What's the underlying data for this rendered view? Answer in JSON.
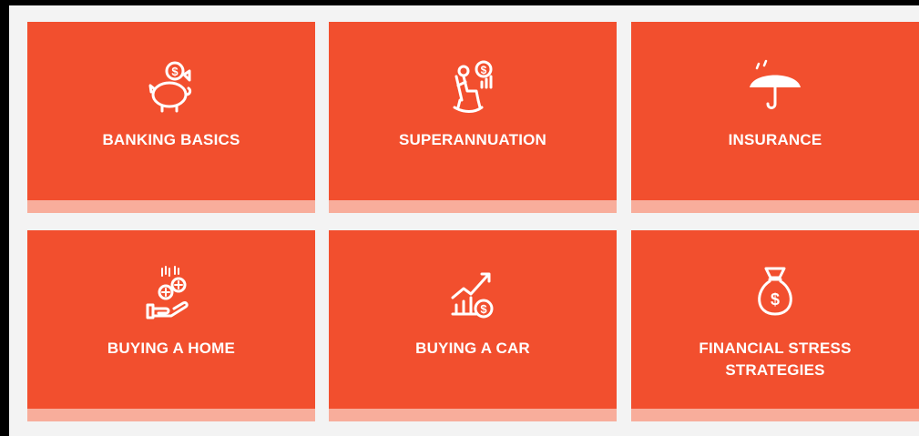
{
  "tiles": [
    {
      "label": "BANKING BASICS",
      "icon": "piggy-bank-icon"
    },
    {
      "label": "SUPERANNUATION",
      "icon": "retiree-rocking-chair-icon"
    },
    {
      "label": "INSURANCE",
      "icon": "umbrella-icon"
    },
    {
      "label": "BUYING A HOME",
      "icon": "hand-coins-icon"
    },
    {
      "label": "BUYING A CAR",
      "icon": "growth-chart-coin-icon"
    },
    {
      "label": "FINANCIAL STRESS\nSTRATEGIES",
      "icon": "money-bag-icon"
    }
  ],
  "colors": {
    "tile": "#f24f2e",
    "stripe": "#f8ad9b",
    "background": "#f3f3f3",
    "text": "#ffffff"
  }
}
